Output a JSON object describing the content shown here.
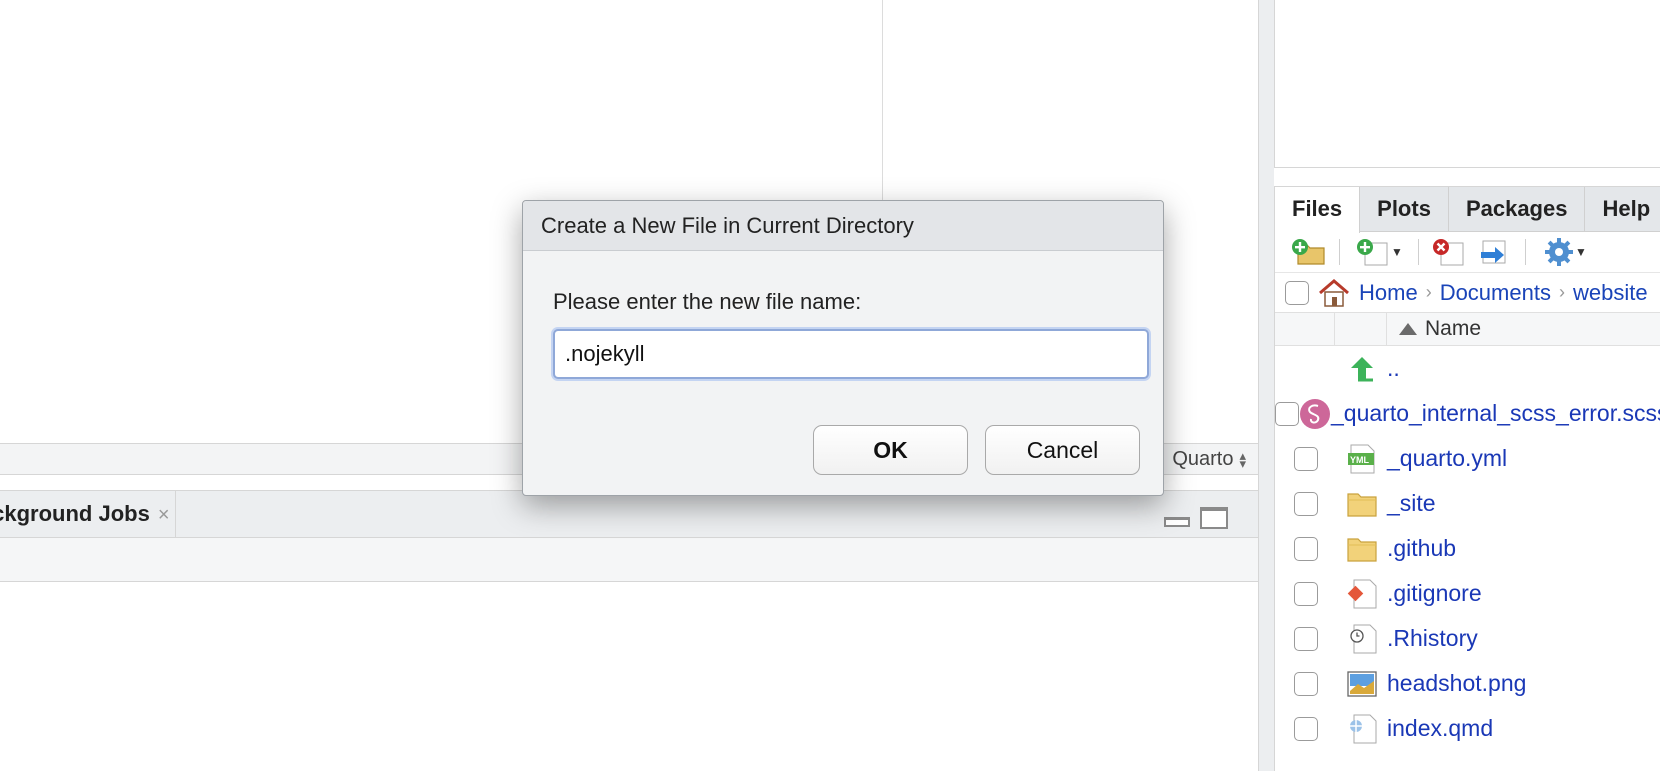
{
  "editor": {
    "doc_type": "Quarto"
  },
  "lower_pane": {
    "tab_label": "Background Jobs",
    "close_glyph": "×"
  },
  "files_pane": {
    "tabs": [
      "Files",
      "Plots",
      "Packages",
      "Help"
    ],
    "breadcrumb": [
      "Home",
      "Documents",
      "website"
    ],
    "column_name": "Name",
    "parent_dir": "..",
    "files": [
      {
        "name": "_quarto_internal_scss_error.scss",
        "icon": "sass-icon"
      },
      {
        "name": "_quarto.yml",
        "icon": "yml-file-icon"
      },
      {
        "name": "_site",
        "icon": "folder-icon"
      },
      {
        "name": ".github",
        "icon": "folder-icon"
      },
      {
        "name": ".gitignore",
        "icon": "git-file-icon"
      },
      {
        "name": ".Rhistory",
        "icon": "history-file-icon"
      },
      {
        "name": "headshot.png",
        "icon": "image-file-icon"
      },
      {
        "name": "index.qmd",
        "icon": "quarto-file-icon"
      }
    ]
  },
  "dialog": {
    "title": "Create a New File in Current Directory",
    "prompt": "Please enter the new file name:",
    "input_value": ".nojekyll",
    "ok_label": "OK",
    "cancel_label": "Cancel"
  }
}
